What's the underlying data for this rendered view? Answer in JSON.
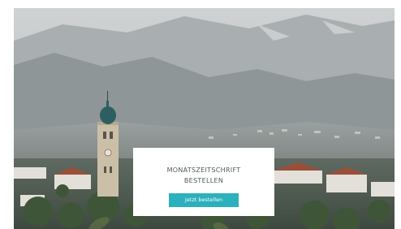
{
  "hero": {
    "image_alt": "Town of Meran with church tower in front of mountains",
    "sky_color": "#c9ccce",
    "mountain_color": "#8e9597",
    "town_color": "#6d7470",
    "tower_color": "#cbbfa8",
    "dome_color": "#2f5e62"
  },
  "cta": {
    "title_line1": "MONATSZEITSCHRIFT",
    "title_line2": "BESTELLEN",
    "button_label": "Jetzt bestellen",
    "button_color": "#2bb0bd"
  }
}
